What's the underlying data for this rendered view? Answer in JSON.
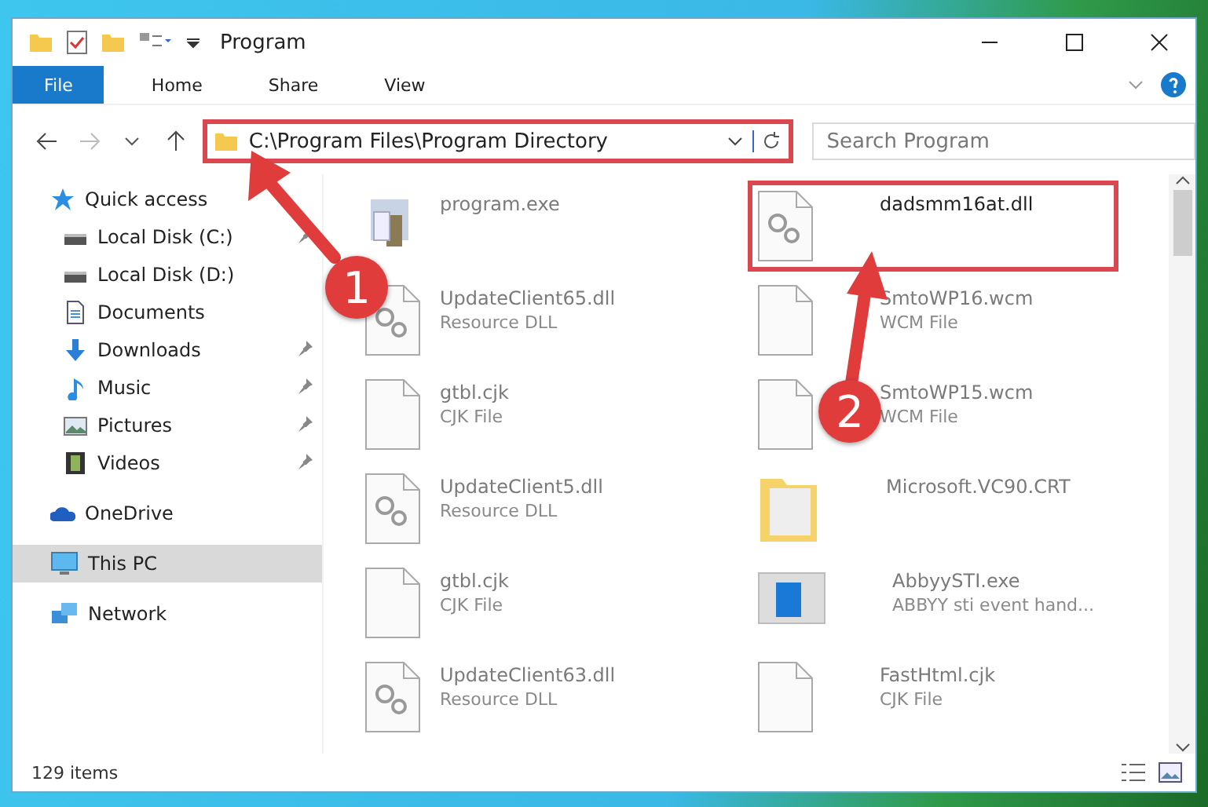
{
  "window": {
    "title": "Program"
  },
  "ribbon_tabs": [
    {
      "label": "File",
      "kind": "menu",
      "selected": false
    },
    {
      "label": "Home",
      "kind": "tab",
      "selected": false
    },
    {
      "label": "Share",
      "kind": "tab",
      "selected": false
    },
    {
      "label": "View",
      "kind": "tab",
      "selected": false
    }
  ],
  "address": {
    "path": "C:\\Program Files\\Program Directory",
    "highlighted": true
  },
  "search": {
    "placeholder": "Search Program"
  },
  "navigation": [
    {
      "label": "Quick access",
      "selected": false,
      "children": [
        {
          "label": "Local Disk (C:)",
          "pinned": true,
          "selected": false
        },
        {
          "label": "Local Disk (D:)",
          "pinned": false,
          "selected": false
        },
        {
          "label": "Documents",
          "pinned": false,
          "selected": false
        },
        {
          "label": "Downloads",
          "pinned": true,
          "selected": false
        },
        {
          "label": "Music",
          "pinned": true,
          "selected": false
        },
        {
          "label": "Pictures",
          "pinned": true,
          "selected": false
        },
        {
          "label": "Videos",
          "pinned": true,
          "selected": false
        }
      ]
    },
    {
      "label": "OneDrive",
      "selected": false
    },
    {
      "label": "This PC",
      "selected": true
    },
    {
      "label": "Network",
      "selected": false
    }
  ],
  "files": [
    {
      "name": "program.exe",
      "kind": "exe",
      "highlighted": false
    },
    {
      "name": "dadsmm16at.dll",
      "kind": "dll",
      "highlighted": true
    },
    {
      "name": "UpdateClient65.dll",
      "type": "Resource DLL",
      "kind": "dll",
      "highlighted": false
    },
    {
      "name": "SmtoWP16.wcm",
      "type": "WCM File",
      "kind": "file",
      "highlighted": false
    },
    {
      "name": "gtbl.cjk",
      "type": "CJK File",
      "kind": "file",
      "highlighted": false
    },
    {
      "name": "SmtoWP15.wcm",
      "type": "WCM File",
      "kind": "file",
      "highlighted": false
    },
    {
      "name": "UpdateClient5.dll",
      "type": "Resource DLL",
      "kind": "dll",
      "highlighted": false
    },
    {
      "name": "Microsoft.VC90.CRT",
      "kind": "folder",
      "highlighted": false
    },
    {
      "name": "gtbl.cjk",
      "type": "CJK File",
      "kind": "file",
      "highlighted": false
    },
    {
      "name": "AbbyySTI.exe",
      "type": "ABBYY sti event hand...",
      "kind": "app",
      "highlighted": false
    },
    {
      "name": "UpdateClient63.dll",
      "type": "Resource DLL",
      "kind": "dll",
      "highlighted": false
    },
    {
      "name": "FastHtml.cjk",
      "type": "CJK File",
      "kind": "file",
      "highlighted": false
    }
  ],
  "status_bar": {
    "item_count": "129 items"
  },
  "annotations": [
    {
      "label": "1"
    },
    {
      "label": "2"
    }
  ]
}
